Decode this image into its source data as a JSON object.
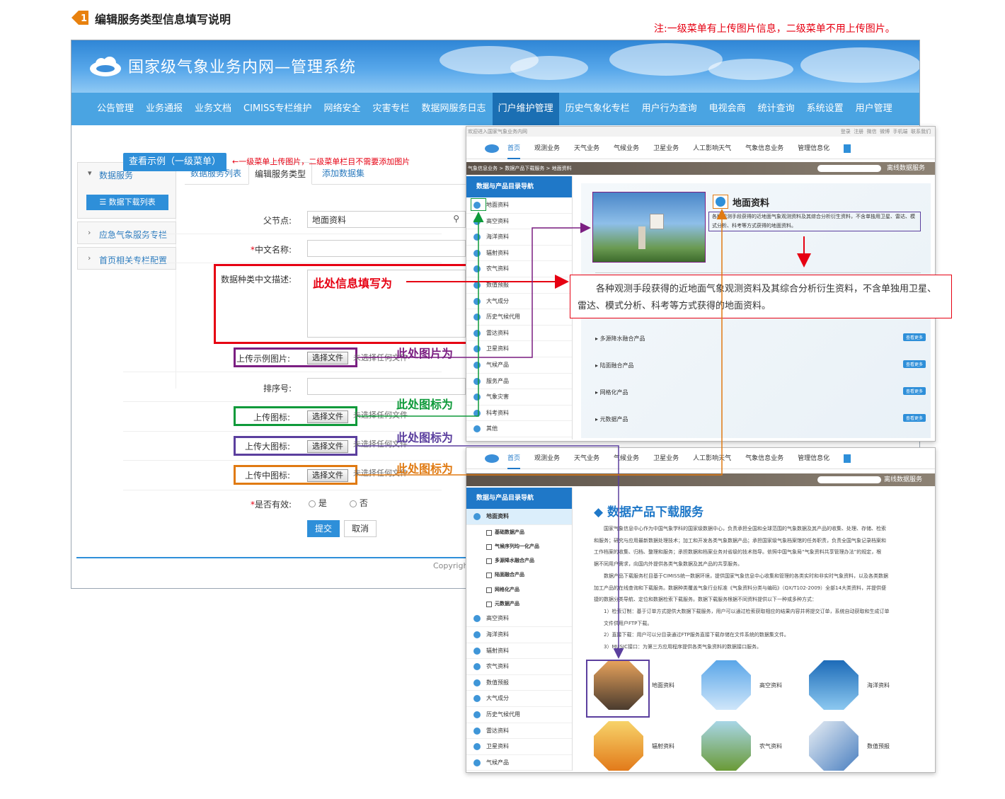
{
  "heading": {
    "badge_number": "1",
    "title": "编辑服务类型信息填写说明",
    "note": "注:一级菜单有上传图片信息，二级菜单不用上传图片。"
  },
  "admin": {
    "system_title": "国家级气象业务内网—管理系统",
    "nav": [
      "公告管理",
      "业务通报",
      "业务文档",
      "CIMISS专栏维护",
      "网络安全",
      "灾害专栏",
      "数据网服务日志",
      "门户维护管理",
      "历史气象化专栏",
      "用户行为查询",
      "电视会商",
      "统计查询",
      "系统设置",
      "用户管理"
    ],
    "nav_active": "门户维护管理",
    "sidebar": {
      "sections": [
        {
          "label": "数据服务",
          "chevron": "v"
        },
        {
          "label": "应急气象服务专栏",
          "chevron": ">"
        },
        {
          "label": "首页相关专栏配置",
          "chevron": ">"
        }
      ],
      "active_item": "数据下载列表"
    },
    "tabs": [
      "数据服务列表",
      "编辑服务类型",
      "添加数据集"
    ],
    "example_button": "查看示例（一级菜单）",
    "example_note": "一级菜单上传图片，二级菜单栏目不需要添加图片",
    "form": {
      "parent_label": "父节点:",
      "parent_value": "地面资料",
      "cn_name_label": "*中文名称:",
      "desc_label": "数据种类中文描述:",
      "example_img_label": "上传示例图片:",
      "order_label": "排序号:",
      "icon_label": "上传图标:",
      "big_icon_label": "上传大图标:",
      "mid_icon_label": "上传中图标:",
      "valid_label": "*是否有效:",
      "yes": "是",
      "no": "否",
      "choose_file": "选择文件",
      "no_file": "未选择任何文件",
      "submit": "提交",
      "cancel": "取消"
    },
    "copyright": "Copyright"
  },
  "annotations": {
    "info": "此处信息填写为",
    "image": "此处图片为",
    "icon1": "此处图标为",
    "icon2": "此处图标为",
    "icon3": "此处图标为",
    "callout_text": "各种观测手段获得的近地面气象观测资料及其综合分析衍生资料，不含单独用卫星、雷达、模式分析、科考等方式获得的地面资料。"
  },
  "portal1": {
    "welcome": "欢迎进入国家气象业务内网",
    "top_links": [
      "登录",
      "注册",
      "微信",
      "微博",
      "手机端",
      "联系我们"
    ],
    "nav": [
      "首页",
      "观测业务",
      "天气业务",
      "气候业务",
      "卫星业务",
      "人工影响天气",
      "气象信息业务",
      "管理信息化"
    ],
    "crumb": "气象信息业务 > 数据产品下载服务 > 地面资料",
    "offline": "离线数据服务",
    "left_head": "数据与产品目录导航",
    "left_items": [
      "地面资料",
      "高空资料",
      "海洋资料",
      "辐射资料",
      "农气资料",
      "数值预报",
      "大气成分",
      "历史气候代用",
      "雷达资料",
      "卫星资料",
      "气候产品",
      "服务产品",
      "气象灾害",
      "科考资料",
      "其他"
    ],
    "detail_title": "地面资料",
    "detail_desc": "各种观测手段获得的近地面气象观测资料及其综合分析衍生资料，不含单独用卫星、雷达、模式分析、科考等方式获得的地面资料。",
    "products": [
      "多源降水融合产品",
      "陆面融合产品",
      "网格化产品",
      "元数据产品"
    ],
    "more": "查看更多"
  },
  "portal2": {
    "nav": [
      "首页",
      "观测业务",
      "天气业务",
      "气候业务",
      "卫星业务",
      "人工影响天气",
      "气象信息业务",
      "管理信息化"
    ],
    "offline": "离线数据服务",
    "left_head": "数据与产品目录导航",
    "left_first": "地面资料",
    "left_subs": [
      "基础数据产品",
      "气候序列均一化产品",
      "多源降水融合产品",
      "陆面融合产品",
      "网格化产品",
      "元数据产品"
    ],
    "left_items": [
      "高空资料",
      "海洋资料",
      "辐射资料",
      "农气资料",
      "数值预报",
      "大气成分",
      "历史气候代用",
      "雷达资料",
      "卫星资料",
      "气候产品"
    ],
    "title": "数据产品下载服务",
    "paragraphs": [
      "国家气象信息中心作为中国气象学科的国家级数据中心，负责承担全国和全球范围的气象数据及其产品的收集、处理、存储、检索",
      "和服务；研究与应用最新数据处理技术；加工和开发各类气象数据产品；承担国家级气象档案馆的任务职责，负责全国气象记录档案和",
      "工作档案的收集、归档、整理和服务；承担数据和档案业务对省级的技术指导。依照中国气象局“气象资料共享管理办法”的规定，根",
      "据不同用户需求，向国内外提供各类气象数据及其产品的共享服务。",
      "数据产品下载服务栏目基于CIMISS统一数据环境，提供国家气象信息中心收集和管理的各类实时和非实时气象资料，以及各类数据",
      "加工产品的在线查询和下载服务。数据种类覆盖气象行业标准《气象资料分类与编码》（QX/T102-2009）全部14大类资料，并提供便",
      "捷的数据分类导航、定位和数据检索下载服务。数据下载服务根据不同资料提供以下一种或多种方式：",
      "1）检索订制：基于订单方式提供大数据下载服务，用户可以通过检索获取相应的结果内容并将提交订单，系统自动获取和生成订单",
      "文件供用户FTP下载。",
      "2）直接下载：用户可以分目录通过FTP服务直接下载存储在文件系统的数据集文件。",
      "3）MUSIC接口：为第三方应用程序提供各类气象资料的数据接口服务。"
    ],
    "tiles": [
      "地面资料",
      "高空资料",
      "海洋资料",
      "辐射资料",
      "农气资料",
      "数值预报"
    ]
  },
  "colors": {
    "red": "#e60012",
    "purple": "#7b1f82",
    "green": "#0e9a3a",
    "violet": "#5b3f9e",
    "orange": "#e07a12",
    "blue": "#2e8fd9"
  }
}
